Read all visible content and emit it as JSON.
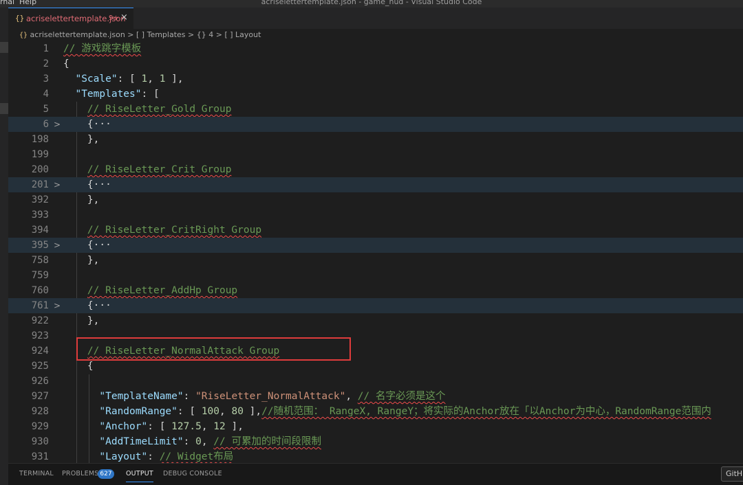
{
  "window": {
    "title": "acriselettertemplate.json - game_hud - Visual Studio Code",
    "menu": [
      "rnal",
      "Help"
    ]
  },
  "tab": {
    "icon": "json-braces-icon",
    "label": "acriselettertemplate.json",
    "badge": "9+",
    "close": "×"
  },
  "breadcrumb": {
    "icon": "{}",
    "file": "acriselettertemplate.json",
    "parts": [
      "[ ] Templates",
      "{} 4",
      "[ ] Layout"
    ],
    "sep": ">"
  },
  "editor": {
    "lines": [
      {
        "num": "1",
        "fold": ""
      },
      {
        "num": "2",
        "fold": ""
      },
      {
        "num": "3",
        "fold": ""
      },
      {
        "num": "4",
        "fold": ""
      },
      {
        "num": "5",
        "fold": ""
      },
      {
        "num": "6",
        "fold": ">"
      },
      {
        "num": "198",
        "fold": ""
      },
      {
        "num": "199",
        "fold": ""
      },
      {
        "num": "200",
        "fold": ""
      },
      {
        "num": "201",
        "fold": ">"
      },
      {
        "num": "392",
        "fold": ""
      },
      {
        "num": "393",
        "fold": ""
      },
      {
        "num": "394",
        "fold": ""
      },
      {
        "num": "395",
        "fold": ">"
      },
      {
        "num": "758",
        "fold": ""
      },
      {
        "num": "759",
        "fold": ""
      },
      {
        "num": "760",
        "fold": ""
      },
      {
        "num": "761",
        "fold": ">"
      },
      {
        "num": "922",
        "fold": ""
      },
      {
        "num": "923",
        "fold": ""
      },
      {
        "num": "924",
        "fold": ""
      },
      {
        "num": "925",
        "fold": ""
      },
      {
        "num": "926",
        "fold": ""
      },
      {
        "num": "927",
        "fold": ""
      },
      {
        "num": "928",
        "fold": ""
      },
      {
        "num": "929",
        "fold": ""
      },
      {
        "num": "930",
        "fold": ""
      },
      {
        "num": "931",
        "fold": ""
      }
    ],
    "tokens": {
      "l1_comment": "// 游戏跳字模板",
      "l2_brace": "{",
      "l3_key": "\"Scale\"",
      "l3_rest_a": ": [ ",
      "l3_n1": "1",
      "l3_rest_b": ", ",
      "l3_n2": "1",
      "l3_rest_c": " ],",
      "l4_key": "\"Templates\"",
      "l4_rest": ": [",
      "l5_comment": "// RiseLetter_Gold Group",
      "l6_fold": "{···",
      "l198_close": "},",
      "l200_comment": "// RiseLetter_Crit Group",
      "l201_fold": "{···",
      "l392_close": "},",
      "l394_comment": "// RiseLetter_CritRight Group",
      "l395_fold": "{···",
      "l758_close": "},",
      "l760_comment": "// RiseLetter_AddHp Group",
      "l761_fold": "{···",
      "l922_close": "},",
      "l924_comment": "// RiseLetter_NormalAttack Group",
      "l925_brace": "{",
      "l927_key": "\"TemplateName\"",
      "l927_colon": ": ",
      "l927_val": "\"RiseLetter_NormalAttack\"",
      "l927_comma": ", ",
      "l927_comment": "// 名字必须是这个",
      "l928_key": "\"RandomRange\"",
      "l928_a": ": [ ",
      "l928_n1": "100",
      "l928_b": ", ",
      "l928_n2": "80",
      "l928_c": " ],",
      "l928_comment": "//随机范围： RangeX, RangeY；将实际的Anchor放在「以Anchor为中心，RandomRange范围内",
      "l929_key": "\"Anchor\"",
      "l929_a": ": [ ",
      "l929_n1": "127.5",
      "l929_b": ", ",
      "l929_n2": "12",
      "l929_c": " ],",
      "l930_key": "\"AddTimeLimit\"",
      "l930_a": ": ",
      "l930_n": "0",
      "l930_b": ", ",
      "l930_comment": "// 可累加的时间段限制",
      "l931_key": "\"Layout\"",
      "l931_a": ": ",
      "l931_comment": "// Widget布局"
    }
  },
  "panel": {
    "tabs": [
      "TERMINAL",
      "PROBLEMS",
      "OUTPUT",
      "DEBUG CONSOLE"
    ],
    "problems_count": "627",
    "active_tab": "OUTPUT",
    "right_button": "GitHub"
  },
  "colors": {
    "background": "#1e1e1e",
    "comment": "#6a9955",
    "key": "#9cdcfe",
    "string": "#ce9178",
    "number": "#b5cea8",
    "highlight_box": "#e03c3c",
    "accent": "#3794ff"
  }
}
